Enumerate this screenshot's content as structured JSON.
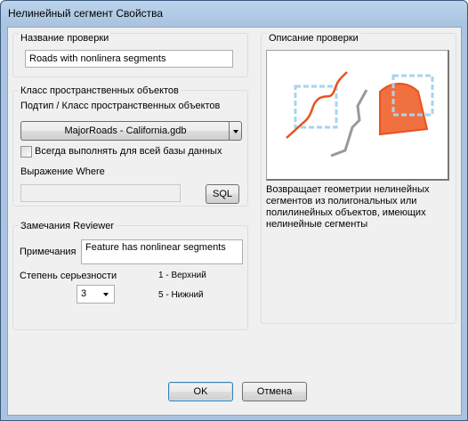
{
  "window": {
    "title": "Нелинейный сегмент Свойства"
  },
  "check_name": {
    "group_title": "Название проверки",
    "value": "Roads with nonlinera segments"
  },
  "feature_class": {
    "group_title": "Класс пространственных объектов",
    "subtype_label": "Подтип / Класс пространственных объектов",
    "selected_class": "MajorRoads -  California.gdb",
    "run_all_label": "Всегда выполнять для всей базы данных",
    "where_label": "Выражение Where",
    "where_value": "",
    "sql_button": "SQL"
  },
  "reviewer_remarks": {
    "group_title": "Замечания Reviewer",
    "notes_label": "Примечания",
    "notes_value": "Feature has nonlinear segments",
    "severity_label": "Степень серьезности",
    "severity_value": "3",
    "severity_high": "1 - Верхний",
    "severity_low": "5 - Нижний"
  },
  "check_description": {
    "group_title": "Описание проверки",
    "text": "Возвращает геометрии нелинейных сегментов из полигональных или полилинейных объектов, имеющих нелинейные сегменты",
    "colors": {
      "highlight": "#e8521b",
      "selection_box": "#a7d4ef",
      "gray_line": "#999999"
    }
  },
  "footer": {
    "ok_label": "OK",
    "cancel_label": "Отмена"
  }
}
